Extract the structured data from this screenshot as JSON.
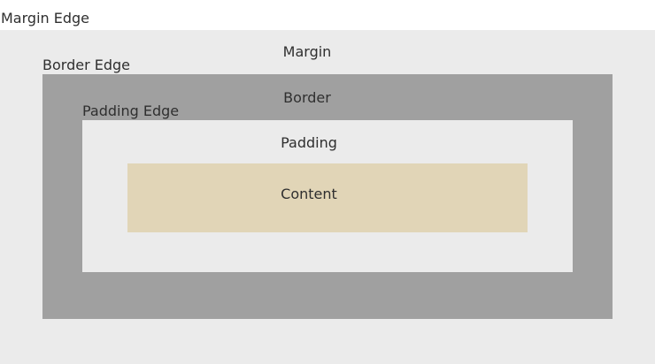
{
  "edges": {
    "margin_edge": "Margin Edge",
    "border_edge": "Border Edge",
    "padding_edge": "Padding Edge"
  },
  "areas": {
    "margin": {
      "label": "Margin",
      "color": "#ebebeb"
    },
    "border": {
      "label": "Border",
      "color": "#a0a0a0"
    },
    "padding": {
      "label": "Padding",
      "color": "#ebebeb"
    },
    "content": {
      "label": "Content",
      "color": "#e1d5b7"
    }
  },
  "text_color": "#2f2f2f"
}
